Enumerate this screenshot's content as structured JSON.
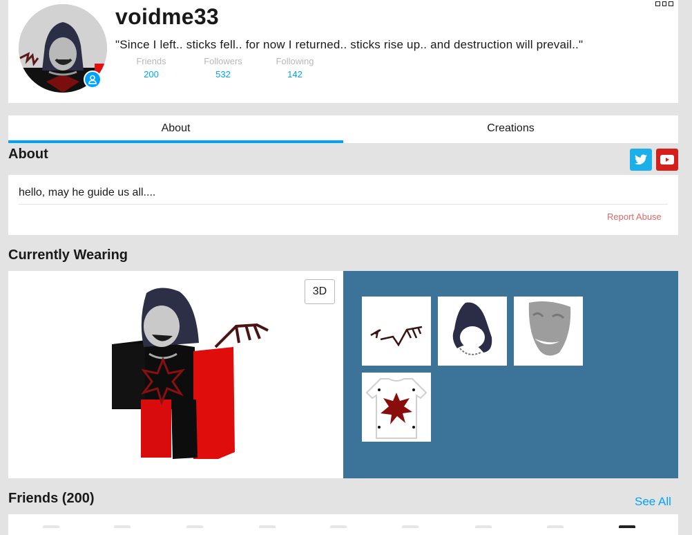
{
  "profile": {
    "username": "voidme33",
    "status": "\"Since I left.. sticks fell.. for now I returned.. sticks rise up.. and destruction will prevail..\"",
    "stats": [
      {
        "label": "Friends",
        "value": "200"
      },
      {
        "label": "Followers",
        "value": "532"
      },
      {
        "label": "Following",
        "value": "142"
      }
    ],
    "presence_icon": "user-icon",
    "more_icon": "more-options-icon"
  },
  "tabs": [
    {
      "label": "About",
      "active": true
    },
    {
      "label": "Creations",
      "active": false
    }
  ],
  "about": {
    "title": "About",
    "text": "hello, may he guide us all....",
    "report_label": "Report Abuse",
    "social": [
      {
        "name": "twitter",
        "icon": "twitter-icon",
        "color": "#1cb0e8"
      },
      {
        "name": "youtube",
        "icon": "youtube-icon",
        "color": "#d4201c"
      }
    ]
  },
  "wearing": {
    "title": "Currently Wearing",
    "toggle_label": "3D",
    "items": [
      {
        "name": "Wings accessory",
        "icon": "wings-icon"
      },
      {
        "name": "Dark hood",
        "icon": "hood-icon"
      },
      {
        "name": "Mask face",
        "icon": "mask-icon"
      },
      {
        "name": "Star t-shirt",
        "icon": "tshirt-icon"
      }
    ]
  },
  "friends": {
    "title": "Friends (200)",
    "see_all_label": "See All"
  },
  "colors": {
    "accent": "#00a2ff",
    "items_panel": "#3c7399",
    "report": "#d86868"
  }
}
